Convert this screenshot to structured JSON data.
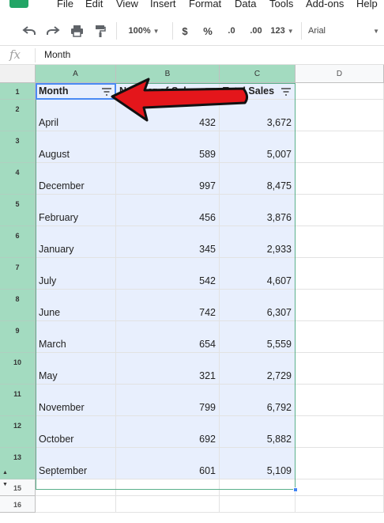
{
  "menu": {
    "items": [
      "File",
      "Edit",
      "View",
      "Insert",
      "Format",
      "Data",
      "Tools",
      "Add-ons",
      "Help"
    ]
  },
  "toolbar": {
    "undo_icon": "undo-icon",
    "redo_icon": "redo-icon",
    "print_icon": "print-icon",
    "paint_format_icon": "paint-format-icon",
    "zoom": "100%",
    "currency": "$",
    "percent": "%",
    "decrease_decimal": ".0",
    "increase_decimal": ".00",
    "more_formats": "123",
    "font": "Arial"
  },
  "formula_bar": {
    "fx_label": "fx",
    "value": "Month"
  },
  "columns": [
    "A",
    "B",
    "C",
    "D"
  ],
  "header_row": {
    "row_number": "1",
    "cells": [
      "Month",
      "Number of Sales",
      "Total Sales"
    ]
  },
  "rows": [
    {
      "row": "2",
      "month": "April",
      "number": "432",
      "total": "3,672"
    },
    {
      "row": "3",
      "month": "August",
      "number": "589",
      "total": "5,007"
    },
    {
      "row": "4",
      "month": "December",
      "number": "997",
      "total": "8,475"
    },
    {
      "row": "5",
      "month": "February",
      "number": "456",
      "total": "3,876"
    },
    {
      "row": "6",
      "month": "January",
      "number": "345",
      "total": "2,933"
    },
    {
      "row": "7",
      "month": "July",
      "number": "542",
      "total": "4,607"
    },
    {
      "row": "8",
      "month": "June",
      "number": "742",
      "total": "6,307"
    },
    {
      "row": "9",
      "month": "March",
      "number": "654",
      "total": "5,559"
    },
    {
      "row": "10",
      "month": "May",
      "number": "321",
      "total": "2,729"
    },
    {
      "row": "11",
      "month": "November",
      "number": "799",
      "total": "6,792"
    },
    {
      "row": "12",
      "month": "October",
      "number": "692",
      "total": "5,882"
    },
    {
      "row": "13",
      "month": "September",
      "number": "601",
      "total": "5,109"
    }
  ],
  "empty_rows": [
    "15",
    "16"
  ],
  "colors": {
    "selected_header": "#a3dbc0",
    "selected_fill": "#e8effd",
    "annotation_arrow": "#e4161b",
    "logo": "#23a566"
  }
}
